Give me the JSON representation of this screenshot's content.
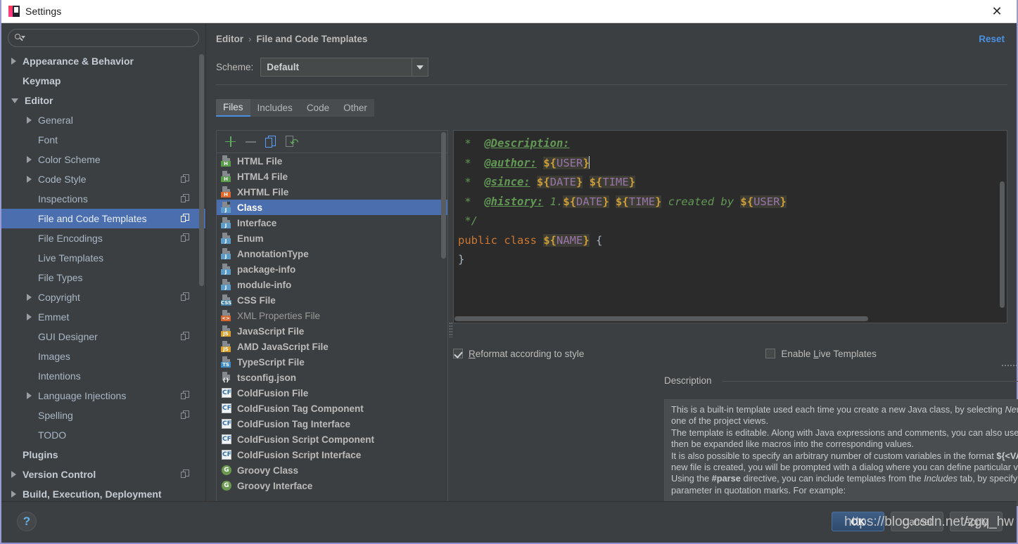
{
  "window": {
    "title": "Settings",
    "close_label": "✕",
    "app_icon": "intellij-idea-icon"
  },
  "sidebar": {
    "search": {
      "value": "",
      "placeholder": ""
    },
    "items": [
      {
        "label": "Appearance & Behavior",
        "indent": 0,
        "arrow": "closed",
        "bold": true,
        "badge": false,
        "selected": false
      },
      {
        "label": "Keymap",
        "indent": 0,
        "arrow": "none",
        "bold": true,
        "badge": false,
        "selected": false
      },
      {
        "label": "Editor",
        "indent": 0,
        "arrow": "open",
        "bold": true,
        "badge": false,
        "selected": false
      },
      {
        "label": "General",
        "indent": 1,
        "arrow": "closed",
        "bold": false,
        "badge": false,
        "selected": false
      },
      {
        "label": "Font",
        "indent": 1,
        "arrow": "none",
        "bold": false,
        "badge": false,
        "selected": false
      },
      {
        "label": "Color Scheme",
        "indent": 1,
        "arrow": "closed",
        "bold": false,
        "badge": false,
        "selected": false
      },
      {
        "label": "Code Style",
        "indent": 1,
        "arrow": "closed",
        "bold": false,
        "badge": true,
        "selected": false
      },
      {
        "label": "Inspections",
        "indent": 1,
        "arrow": "none",
        "bold": false,
        "badge": true,
        "selected": false
      },
      {
        "label": "File and Code Templates",
        "indent": 1,
        "arrow": "none",
        "bold": false,
        "badge": true,
        "selected": true
      },
      {
        "label": "File Encodings",
        "indent": 1,
        "arrow": "none",
        "bold": false,
        "badge": true,
        "selected": false
      },
      {
        "label": "Live Templates",
        "indent": 1,
        "arrow": "none",
        "bold": false,
        "badge": false,
        "selected": false
      },
      {
        "label": "File Types",
        "indent": 1,
        "arrow": "none",
        "bold": false,
        "badge": false,
        "selected": false
      },
      {
        "label": "Copyright",
        "indent": 1,
        "arrow": "closed",
        "bold": false,
        "badge": true,
        "selected": false
      },
      {
        "label": "Emmet",
        "indent": 1,
        "arrow": "closed",
        "bold": false,
        "badge": false,
        "selected": false
      },
      {
        "label": "GUI Designer",
        "indent": 1,
        "arrow": "none",
        "bold": false,
        "badge": true,
        "selected": false
      },
      {
        "label": "Images",
        "indent": 1,
        "arrow": "none",
        "bold": false,
        "badge": false,
        "selected": false
      },
      {
        "label": "Intentions",
        "indent": 1,
        "arrow": "none",
        "bold": false,
        "badge": false,
        "selected": false
      },
      {
        "label": "Language Injections",
        "indent": 1,
        "arrow": "closed",
        "bold": false,
        "badge": true,
        "selected": false
      },
      {
        "label": "Spelling",
        "indent": 1,
        "arrow": "none",
        "bold": false,
        "badge": true,
        "selected": false
      },
      {
        "label": "TODO",
        "indent": 1,
        "arrow": "none",
        "bold": false,
        "badge": false,
        "selected": false
      },
      {
        "label": "Plugins",
        "indent": 0,
        "arrow": "none",
        "bold": true,
        "badge": false,
        "selected": false
      },
      {
        "label": "Version Control",
        "indent": 0,
        "arrow": "closed",
        "bold": true,
        "badge": true,
        "selected": false
      },
      {
        "label": "Build, Execution, Deployment",
        "indent": 0,
        "arrow": "closed",
        "bold": true,
        "badge": false,
        "selected": false
      }
    ]
  },
  "content": {
    "breadcrumb": {
      "parent": "Editor",
      "separator": "›",
      "current": "File and Code Templates"
    },
    "reset_label": "Reset",
    "scheme": {
      "label": "Scheme:",
      "value": "Default"
    },
    "tabs": [
      {
        "label": "Files",
        "active": true
      },
      {
        "label": "Includes",
        "active": false
      },
      {
        "label": "Code",
        "active": false
      },
      {
        "label": "Other",
        "active": false
      }
    ],
    "toolbar": {
      "add": "+",
      "remove": "−",
      "copy": "copy-template",
      "reset": "reset-to-default"
    },
    "templates": [
      {
        "label": "HTML File",
        "icon": "html",
        "tag": "H",
        "selected": false,
        "dim": false
      },
      {
        "label": "HTML4 File",
        "icon": "html",
        "tag": "H",
        "selected": false,
        "dim": false
      },
      {
        "label": "XHTML File",
        "icon": "xhtml",
        "tag": "H",
        "selected": false,
        "dim": false
      },
      {
        "label": "Class",
        "icon": "java",
        "tag": "J",
        "selected": true,
        "dim": false
      },
      {
        "label": "Interface",
        "icon": "java",
        "tag": "J",
        "selected": false,
        "dim": false
      },
      {
        "label": "Enum",
        "icon": "java",
        "tag": "J",
        "selected": false,
        "dim": false
      },
      {
        "label": "AnnotationType",
        "icon": "java",
        "tag": "J",
        "selected": false,
        "dim": false
      },
      {
        "label": "package-info",
        "icon": "java",
        "tag": "J",
        "selected": false,
        "dim": false
      },
      {
        "label": "module-info",
        "icon": "java",
        "tag": "J",
        "selected": false,
        "dim": false
      },
      {
        "label": "CSS File",
        "icon": "css",
        "tag": "CSS",
        "selected": false,
        "dim": false
      },
      {
        "label": "XML Properties File",
        "icon": "xml",
        "tag": "<>",
        "selected": false,
        "dim": true
      },
      {
        "label": "JavaScript File",
        "icon": "js",
        "tag": "JS",
        "selected": false,
        "dim": false
      },
      {
        "label": "AMD JavaScript File",
        "icon": "js",
        "tag": "JS",
        "selected": false,
        "dim": false
      },
      {
        "label": "TypeScript File",
        "icon": "ts",
        "tag": "TS",
        "selected": false,
        "dim": false
      },
      {
        "label": "tsconfig.json",
        "icon": "json",
        "tag": "{}",
        "selected": false,
        "dim": false
      },
      {
        "label": "ColdFusion File",
        "icon": "cf",
        "tag": "CF",
        "selected": false,
        "dim": false
      },
      {
        "label": "ColdFusion Tag Component",
        "icon": "cf",
        "tag": "CF",
        "selected": false,
        "dim": false
      },
      {
        "label": "ColdFusion Tag Interface",
        "icon": "cf",
        "tag": "CF",
        "selected": false,
        "dim": false
      },
      {
        "label": "ColdFusion Script Component",
        "icon": "cf",
        "tag": "CF",
        "selected": false,
        "dim": false
      },
      {
        "label": "ColdFusion Script Interface",
        "icon": "cf",
        "tag": "CF",
        "selected": false,
        "dim": false
      },
      {
        "label": "Groovy Class",
        "icon": "groovy",
        "tag": "G",
        "selected": false,
        "dim": false
      },
      {
        "label": "Groovy Interface",
        "icon": "groovy",
        "tag": "G",
        "selected": false,
        "dim": false
      }
    ],
    "editor": {
      "lines": [
        " *  @Description:",
        " *  @author: ${USER}",
        " *  @since: ${DATE} ${TIME}",
        " *  @history: 1.${DATE} ${TIME} created by ${USER}",
        " */",
        "public class ${NAME} {",
        "}"
      ]
    },
    "options": {
      "reformat": {
        "label": "Reformat according to style",
        "mnemonic": "R",
        "checked": true
      },
      "live_templates": {
        "label": "Enable Live Templates",
        "mnemonic": "L",
        "checked": false
      }
    },
    "description": {
      "title": "Description",
      "paragraphs": [
        "This is a built-in template used each time you create a new Java class, by selecting <i>New</i> | <i>Java Class</i> | <i>Class</i> from the popup menu in one of the project views.",
        "The template is editable. Along with Java expressions and comments, you can also use predefined variables (listed below) that will then be expanded like macros into the corresponding values.",
        "It is also possible to specify an arbitrary number of custom variables in the format <b>${&lt;VARIABLE_NAME&gt;}</b>. In this case, before the new file is created, you will be prompted with a dialog where you can define particular values for all custom variables.",
        "Using the <b>#parse</b> directive, you can include templates from the <i>Includes</i> tab, by specifying the full name of the desired template as a parameter in quotation marks. For example:"
      ]
    }
  },
  "footer": {
    "help_label": "?",
    "buttons": [
      {
        "label": "OK",
        "primary": true
      },
      {
        "label": "Cancel",
        "primary": false
      },
      {
        "label": "Apply",
        "primary": false
      }
    ],
    "watermark": "https://blog.csdn.net/zgq_hw"
  }
}
